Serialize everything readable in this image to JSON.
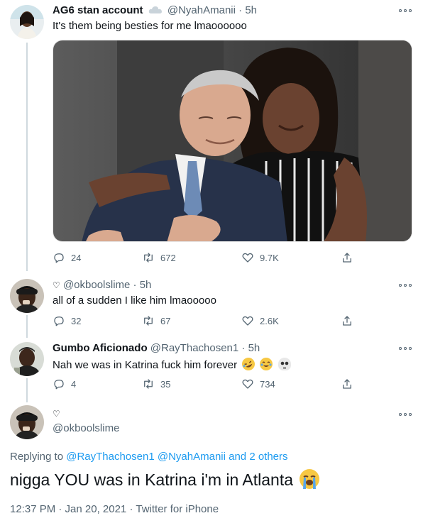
{
  "tweets": [
    {
      "name": "AG6 stan account",
      "name_emoji": "cloud-emoji",
      "handle": "@NyahAmanii",
      "time": "5h",
      "text": "It's them being besties for me lmaoooooo",
      "replies": "24",
      "retweets": "672",
      "likes": "9.7K"
    },
    {
      "name": "",
      "name_symbol": "♡",
      "handle": "@okboolslime",
      "time": "5h",
      "text": "all of a sudden I like him lmaooooo",
      "replies": "32",
      "retweets": "67",
      "likes": "2.6K"
    },
    {
      "name": "Gumbo Aficionado",
      "handle": "@RayThachosen1",
      "time": "5h",
      "text": "Nah we was in Katrina fuck him forever",
      "emojis": [
        "rolling-laughing-emoji",
        "tears-of-joy-emoji",
        "skull-emoji"
      ],
      "replies": "4",
      "retweets": "35",
      "likes": "734"
    }
  ],
  "main_tweet": {
    "name_symbol": "♡",
    "handle": "@okboolslime",
    "replying_label": "Replying to",
    "replying_handles": [
      "@RayThachosen1",
      "@NyahAmanii"
    ],
    "replying_others": "and 2 others",
    "text": "nigga YOU was in Katrina i'm in Atlanta",
    "emoji": "loudly-crying-emoji",
    "timestamp": "12:37 PM · Jan 20, 2021",
    "source": "Twitter for iPhone"
  },
  "separator": "·",
  "colors": {
    "text": "#0f1419",
    "secondary": "#536471",
    "link": "#1d9bf0",
    "thread": "#cfd9de"
  }
}
